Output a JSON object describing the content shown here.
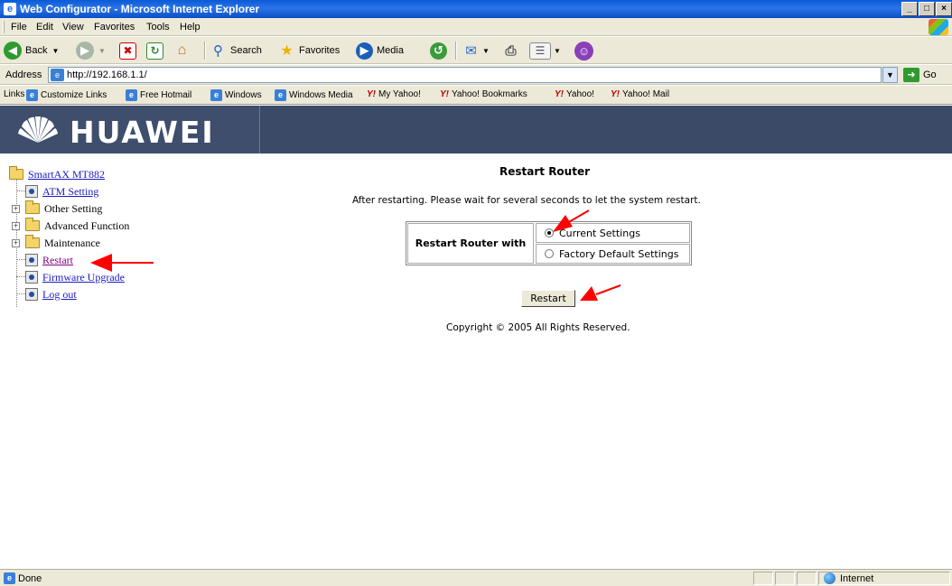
{
  "window": {
    "title": "Web Configurator - Microsoft Internet Explorer",
    "controls": [
      "_",
      "□",
      "×"
    ]
  },
  "menu": [
    "File",
    "Edit",
    "View",
    "Favorites",
    "Tools",
    "Help"
  ],
  "toolbar": {
    "back": "Back",
    "search": "Search",
    "favorites": "Favorites",
    "media": "Media"
  },
  "address": {
    "label": "Address",
    "url": "http://192.168.1.1/",
    "go": "Go"
  },
  "links": {
    "label": "Links",
    "items": [
      "Customize Links",
      "Free Hotmail",
      "Windows",
      "Windows Media",
      "My Yahoo!",
      "Yahoo! Bookmarks",
      "Yahoo!",
      "Yahoo! Mail"
    ]
  },
  "banner": {
    "brand": "HUAWEI"
  },
  "tree": {
    "root": "SmartAX MT882",
    "items": [
      {
        "label": "ATM Setting",
        "link": true
      },
      {
        "label": "Other Setting",
        "link": false
      },
      {
        "label": "Advanced Function",
        "link": false
      },
      {
        "label": "Maintenance",
        "link": false
      },
      {
        "label": "Restart",
        "link": true
      },
      {
        "label": "Firmware Upgrade",
        "link": true
      },
      {
        "label": "Log out",
        "link": true
      }
    ]
  },
  "main": {
    "title": "Restart Router",
    "instruction": "After restarting. Please wait for several seconds to let the system restart.",
    "table_label": "Restart Router with",
    "options": [
      {
        "label": "Current Settings",
        "checked": true
      },
      {
        "label": "Factory Default Settings",
        "checked": false
      }
    ],
    "button": "Restart",
    "copyright": "Copyright © 2005 All Rights Reserved."
  },
  "status": {
    "text": "Done",
    "zone": "Internet"
  },
  "colors": {
    "annotation_arrow": "#ff0000",
    "banner": "#3b4a66",
    "link": "#1a1ac8",
    "visited_link": "#800080"
  }
}
